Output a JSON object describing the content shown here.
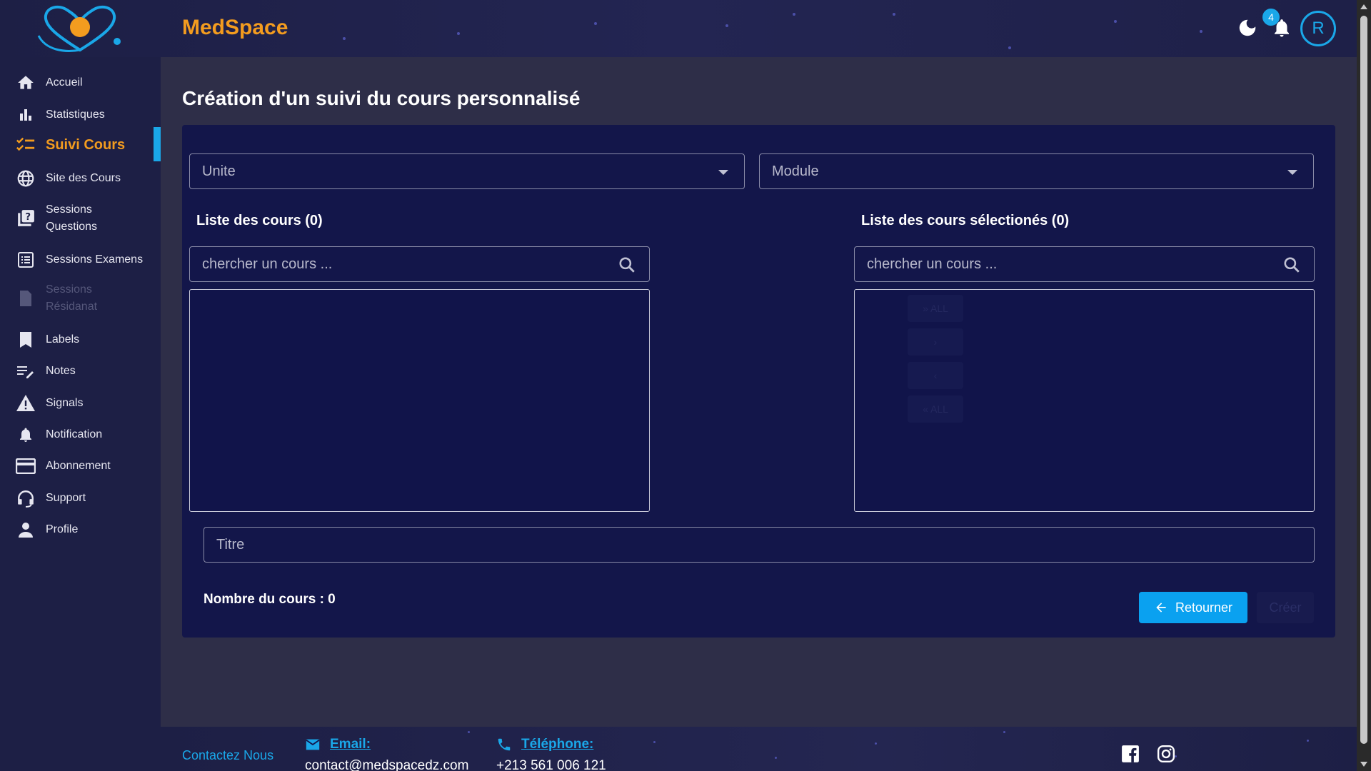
{
  "app": {
    "brand": "MedSpace",
    "notification_count": "4",
    "avatar_initial": "R",
    "accent_color": "#1aa7e8",
    "brand_color": "#f39c1f"
  },
  "sidebar": {
    "items": [
      {
        "label": "Accueil",
        "icon": "home-icon"
      },
      {
        "label": "Statistiques",
        "icon": "bar-chart-icon"
      },
      {
        "label": "Suivi Cours",
        "icon": "checklist-icon",
        "active": true
      },
      {
        "label": "Site des Cours",
        "icon": "globe-icon"
      },
      {
        "label": "Sessions Questions",
        "icon": "question-book-icon"
      },
      {
        "label": "Sessions Examens",
        "icon": "list-icon"
      },
      {
        "label": "Sessions Résidanat",
        "icon": "document-icon",
        "disabled": true
      },
      {
        "label": "Labels",
        "icon": "bookmark-icon"
      },
      {
        "label": "Notes",
        "icon": "edit-note-icon"
      },
      {
        "label": "Signals",
        "icon": "warning-icon"
      },
      {
        "label": "Notification",
        "icon": "bell-icon"
      },
      {
        "label": "Abonnement",
        "icon": "credit-card-icon"
      },
      {
        "label": "Support",
        "icon": "headset-icon"
      },
      {
        "label": "Profile",
        "icon": "person-icon"
      }
    ]
  },
  "main": {
    "title": "Création d'un suivi du cours personnalisé",
    "unite_placeholder": "Unite",
    "module_placeholder": "Module",
    "list_left_title": "Liste des cours (0)",
    "list_right_title": "Liste des cours sélectionés (0)",
    "search_placeholder": "chercher un cours ...",
    "transfer": {
      "move_all_right": "» ALL",
      "move_right": "›",
      "move_left": "‹",
      "move_all_left": "« ALL"
    },
    "titre_placeholder": "Titre",
    "count_label": "Nombre du cours : 0",
    "return_button": "Retourner",
    "create_button": "Créer"
  },
  "footer": {
    "contact": "Contactez Nous",
    "email_label": "Email:",
    "email_value": "contact@medspacedz.com",
    "phone_label": "Téléphone:",
    "phone_value": "+213 561 006 121"
  }
}
